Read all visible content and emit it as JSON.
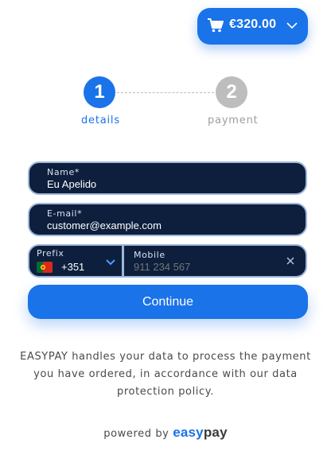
{
  "cart": {
    "amount": "€320.00",
    "icon": "shopping-cart-icon"
  },
  "stepper": {
    "steps": [
      {
        "number": "1",
        "label": "details",
        "state": "active"
      },
      {
        "number": "2",
        "label": "payment",
        "state": "inactive"
      }
    ]
  },
  "form": {
    "name": {
      "label": "Name*",
      "value": "Eu Apelido"
    },
    "email": {
      "label": "E-mail*",
      "value": "customer@example.com"
    },
    "prefix": {
      "label": "Prefix",
      "value": "+351",
      "flag": "portugal-flag-icon"
    },
    "mobile": {
      "label": "Mobile",
      "placeholder": "911 234 567"
    },
    "continue_label": "Continue"
  },
  "footer": {
    "notice": "EASYPAY handles your data to process the payment you have ordered, in accordance with our data protection policy.",
    "powered_by": "powered by",
    "logo_part1": "easy",
    "logo_part2": "pay"
  },
  "colors": {
    "accent": "#1a73e8",
    "field_bg": "#0d1f3c",
    "field_border": "#9eb6d8",
    "inactive": "#bdbdbd"
  }
}
